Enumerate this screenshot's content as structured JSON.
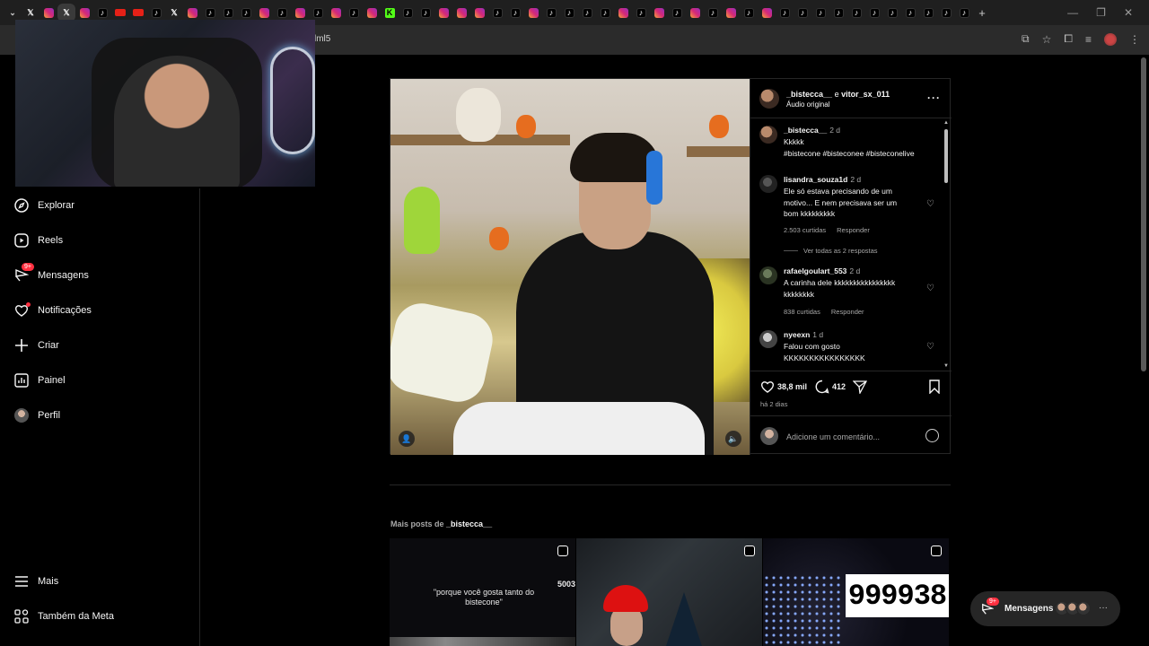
{
  "browser": {
    "url_fragment": "lml5",
    "tabs": [
      {
        "icon": "x-icon"
      },
      {
        "icon": "instagram-icon"
      },
      {
        "icon": "x-icon",
        "active": true
      },
      {
        "icon": "instagram-icon"
      },
      {
        "icon": "tiktok-icon"
      },
      {
        "icon": "youtube-icon"
      },
      {
        "icon": "youtube-icon"
      },
      {
        "icon": "tiktok-icon"
      },
      {
        "icon": "x-icon"
      },
      {
        "icon": "instagram-icon"
      },
      {
        "icon": "tiktok-icon"
      },
      {
        "icon": "tiktok-icon"
      },
      {
        "icon": "tiktok-icon"
      },
      {
        "icon": "instagram-icon"
      },
      {
        "icon": "tiktok-icon"
      },
      {
        "icon": "instagram-icon"
      },
      {
        "icon": "tiktok-icon"
      },
      {
        "icon": "instagram-icon"
      },
      {
        "icon": "tiktok-icon"
      },
      {
        "icon": "instagram-icon"
      },
      {
        "icon": "kick-icon"
      },
      {
        "icon": "tiktok-icon"
      },
      {
        "icon": "tiktok-icon"
      },
      {
        "icon": "instagram-icon"
      },
      {
        "icon": "instagram-icon"
      },
      {
        "icon": "instagram-icon"
      },
      {
        "icon": "tiktok-icon"
      },
      {
        "icon": "tiktok-icon"
      },
      {
        "icon": "instagram-icon"
      },
      {
        "icon": "tiktok-icon"
      },
      {
        "icon": "tiktok-icon"
      },
      {
        "icon": "tiktok-icon"
      },
      {
        "icon": "tiktok-icon"
      },
      {
        "icon": "instagram-icon"
      },
      {
        "icon": "tiktok-icon"
      },
      {
        "icon": "instagram-icon"
      },
      {
        "icon": "tiktok-icon"
      },
      {
        "icon": "instagram-icon"
      },
      {
        "icon": "tiktok-icon"
      },
      {
        "icon": "instagram-icon"
      },
      {
        "icon": "tiktok-icon"
      },
      {
        "icon": "instagram-icon"
      },
      {
        "icon": "tiktok-icon"
      },
      {
        "icon": "tiktok-icon"
      },
      {
        "icon": "tiktok-icon"
      },
      {
        "icon": "tiktok-icon"
      },
      {
        "icon": "tiktok-icon"
      },
      {
        "icon": "tiktok-icon"
      },
      {
        "icon": "tiktok-icon"
      },
      {
        "icon": "tiktok-icon"
      },
      {
        "icon": "tiktok-icon"
      },
      {
        "icon": "tiktok-icon"
      },
      {
        "icon": "tiktok-icon"
      }
    ],
    "new_tab": "+"
  },
  "sidebar": {
    "items": [
      {
        "label": "Explorar",
        "icon": "compass-icon"
      },
      {
        "label": "Reels",
        "icon": "reels-icon"
      },
      {
        "label": "Mensagens",
        "icon": "messenger-icon",
        "badge": "9+"
      },
      {
        "label": "Notificações",
        "icon": "heart-icon"
      },
      {
        "label": "Criar",
        "icon": "plus-icon"
      },
      {
        "label": "Painel",
        "icon": "dashboard-icon"
      },
      {
        "label": "Perfil",
        "icon": "profile-avatar"
      }
    ],
    "bottom": [
      {
        "label": "Mais",
        "icon": "menu-icon"
      },
      {
        "label": "Também da Meta",
        "icon": "meta-icon"
      }
    ]
  },
  "post": {
    "header": {
      "user1": "_bistecca__",
      "conj": "e",
      "user2": "vitor_sx_011",
      "audio": "Áudio original"
    },
    "caption": {
      "user": "_bistecca__",
      "time": "2 d",
      "text": "Kkkkk",
      "tags": "#bistecone #bisteconee #bisteconelive"
    },
    "comments": [
      {
        "user": "lisandra_souza1d",
        "time": "2 d",
        "text": "Ele só estava precisando de um motivo... E nem precisava ser um bom kkkkkkkkk",
        "likes": "2.503 curtidas",
        "reply": "Responder",
        "view_replies": "Ver todas as 2 respostas"
      },
      {
        "user": "rafaelgoulart_553",
        "time": "2 d",
        "text": "A carinha dele kkkkkkkkkkkkkkkkkkkkkkkk",
        "likes": "838 curtidas",
        "reply": "Responder"
      },
      {
        "user": "nyeexn",
        "time": "1 d",
        "text": "Falou com gosto KKKKKKKKKKKKKKKK"
      }
    ],
    "likes": "38,8 mil",
    "comments_count": "412",
    "ago": "há 2 dias",
    "add_comment_placeholder": "Adicione um comentário..."
  },
  "more_posts": {
    "prefix": "Mais posts de",
    "user": "_bistecca__",
    "thumb1_caption": "\"porque você gosta tanto do bistecone\"",
    "thumb1_num": "5003",
    "thumb3_num": "999938"
  },
  "messages_pill": {
    "label": "Mensagens",
    "badge": "9+"
  },
  "colors": {
    "background": "#000000",
    "border": "#262626",
    "muted_text": "#a8a8a8",
    "notification_red": "#ff3040",
    "hashtag": "#e0f1ff"
  }
}
